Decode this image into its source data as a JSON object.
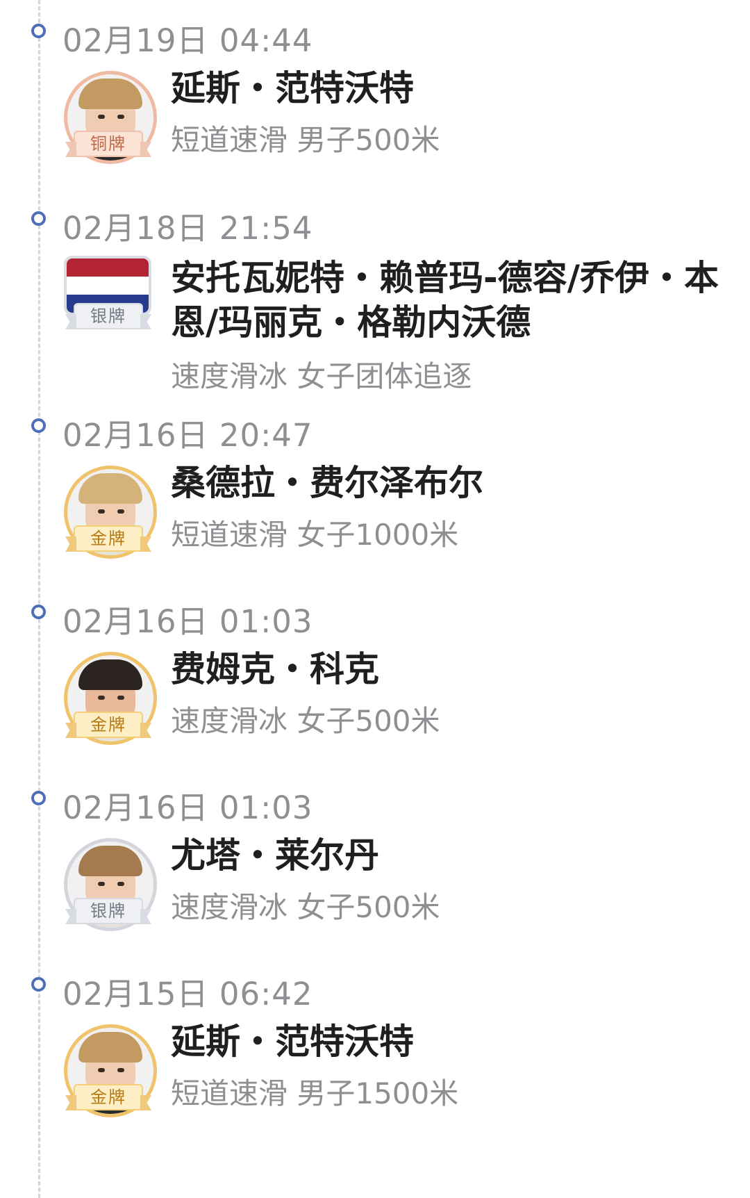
{
  "entries": [
    {
      "time": "02月19日 04:44",
      "name": "延斯・范特沃特",
      "event": "短道速滑 男子500米",
      "medal": "铜牌",
      "medal_type": "bronze",
      "avatar": "athlete-photo"
    },
    {
      "time": "02月18日 21:54",
      "name": "安托瓦妮特・赖普玛-德容/乔伊・本恩/玛丽克・格勒内沃德",
      "event": "速度滑冰 女子团体追逐",
      "medal": "银牌",
      "medal_type": "silver",
      "avatar": "netherlands-flag"
    },
    {
      "time": "02月16日 20:47",
      "name": "桑德拉・费尔泽布尔",
      "event": "短道速滑 女子1000米",
      "medal": "金牌",
      "medal_type": "gold",
      "avatar": "athlete-photo"
    },
    {
      "time": "02月16日 01:03",
      "name": "费姆克・科克",
      "event": "速度滑冰 女子500米",
      "medal": "金牌",
      "medal_type": "gold",
      "avatar": "athlete-photo"
    },
    {
      "time": "02月16日 01:03",
      "name": "尤塔・莱尔丹",
      "event": "速度滑冰 女子500米",
      "medal": "银牌",
      "medal_type": "silver",
      "avatar": "athlete-photo"
    },
    {
      "time": "02月15日 06:42",
      "name": "延斯・范特沃特",
      "event": "短道速滑 男子1500米",
      "medal": "金牌",
      "medal_type": "gold",
      "avatar": "athlete-photo"
    }
  ]
}
